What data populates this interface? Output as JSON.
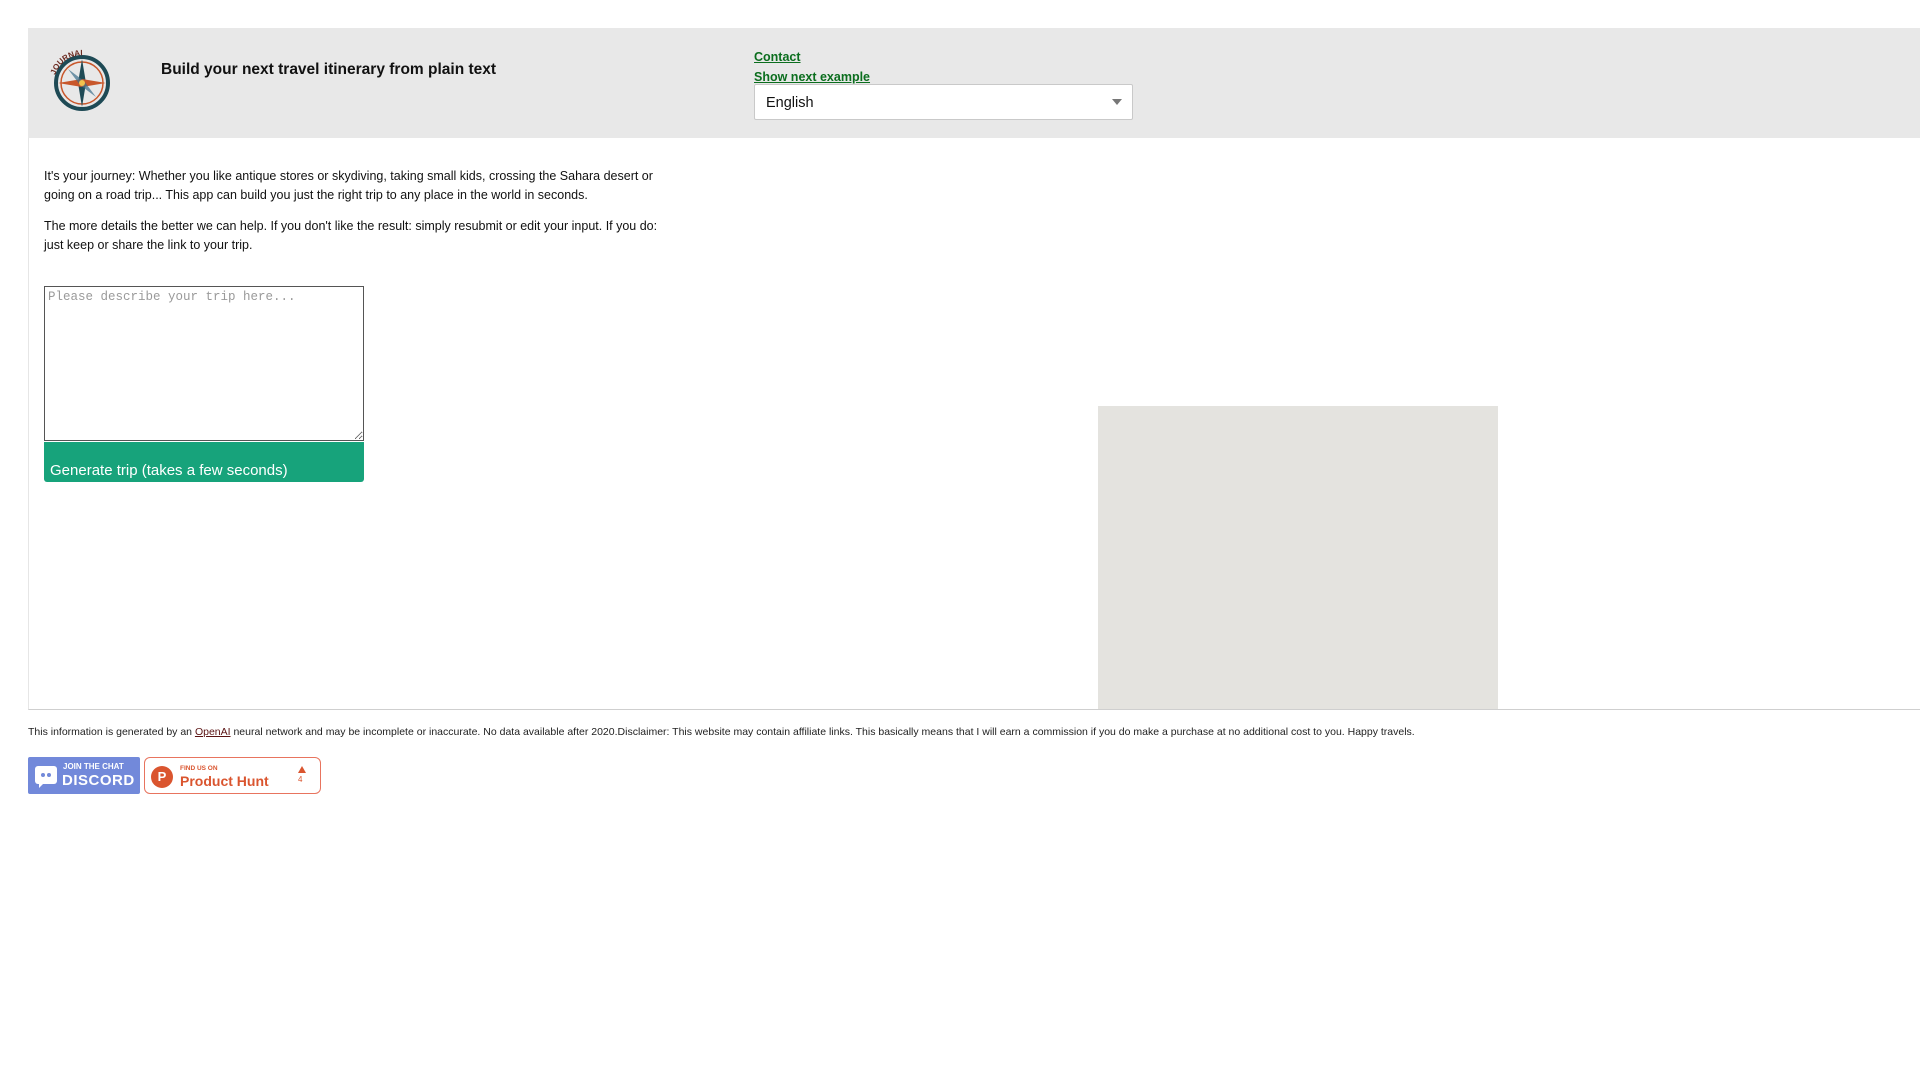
{
  "header": {
    "title": "Build your next travel itinerary from plain text",
    "logo_text": "JOURNAI",
    "links": {
      "contact": "Contact",
      "next_example": "Show next example"
    },
    "language_select": {
      "selected": "English"
    }
  },
  "intro": {
    "paragraph1": "It's your journey: Whether you like antique stores or skydiving, taking small kids, crossing the Sahara desert or going on a road trip... This app can build you just the right trip to any place in the world in seconds.",
    "paragraph2": "The more details the better we can help. If you don't like the result: simply resubmit or edit your input. If you do: just keep or share the link to your trip."
  },
  "form": {
    "placeholder": "Please describe your trip here...",
    "value": "",
    "submit_label": "Generate trip (takes a few seconds)"
  },
  "footer": {
    "text_before": "This information is generated by an ",
    "openai_link": "OpenAI",
    "text_after": " neural network and may be incomplete or inaccurate. No data available after 2020.Disclaimer: This website may contain affiliate links. This basically means that I will earn a commission if you do make a purchase at no additional cost to you. Happy travels."
  },
  "badges": {
    "discord": {
      "small": "JOIN THE CHAT",
      "big": "DISCORD"
    },
    "product_hunt": {
      "small": "FIND US ON",
      "big": "Product Hunt",
      "letter": "P",
      "count": "4"
    }
  },
  "colors": {
    "header_bg": "#e8e8e8",
    "link": "#0b6e1e",
    "button": "#17a37b",
    "map_placeholder": "#e4e3df",
    "discord": "#7289da",
    "product_hunt": "#da552f"
  }
}
